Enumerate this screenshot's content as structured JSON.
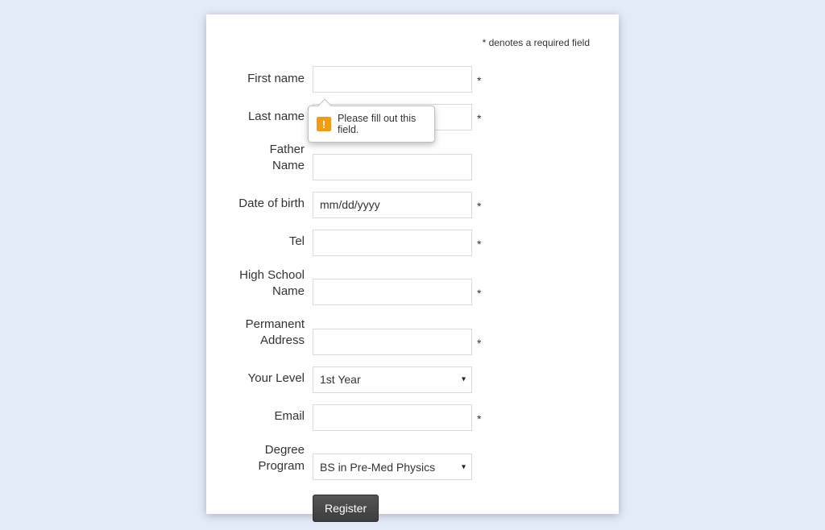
{
  "required_note": "* denotes a required field",
  "fields": {
    "first_name": {
      "label": "First name",
      "required": true
    },
    "last_name": {
      "label": "Last name",
      "required": true
    },
    "father_name": {
      "label": "Father Name",
      "required": false
    },
    "dob": {
      "label": "Date of birth",
      "required": true,
      "placeholder": "mm/dd/yyyy"
    },
    "tel": {
      "label": "Tel",
      "required": true
    },
    "highschool": {
      "label": "High School Name",
      "required": true
    },
    "address": {
      "label": "Permanent Address",
      "required": true
    },
    "level": {
      "label": "Your Level",
      "required": false,
      "selected": "1st Year"
    },
    "email": {
      "label": "Email",
      "required": true
    },
    "degree": {
      "label": "Degree Program",
      "required": false,
      "selected": "BS in Pre-Med Physics"
    }
  },
  "tooltip": {
    "text": "Please fill out this field."
  },
  "button": {
    "register": "Register"
  },
  "asterisk": "*"
}
